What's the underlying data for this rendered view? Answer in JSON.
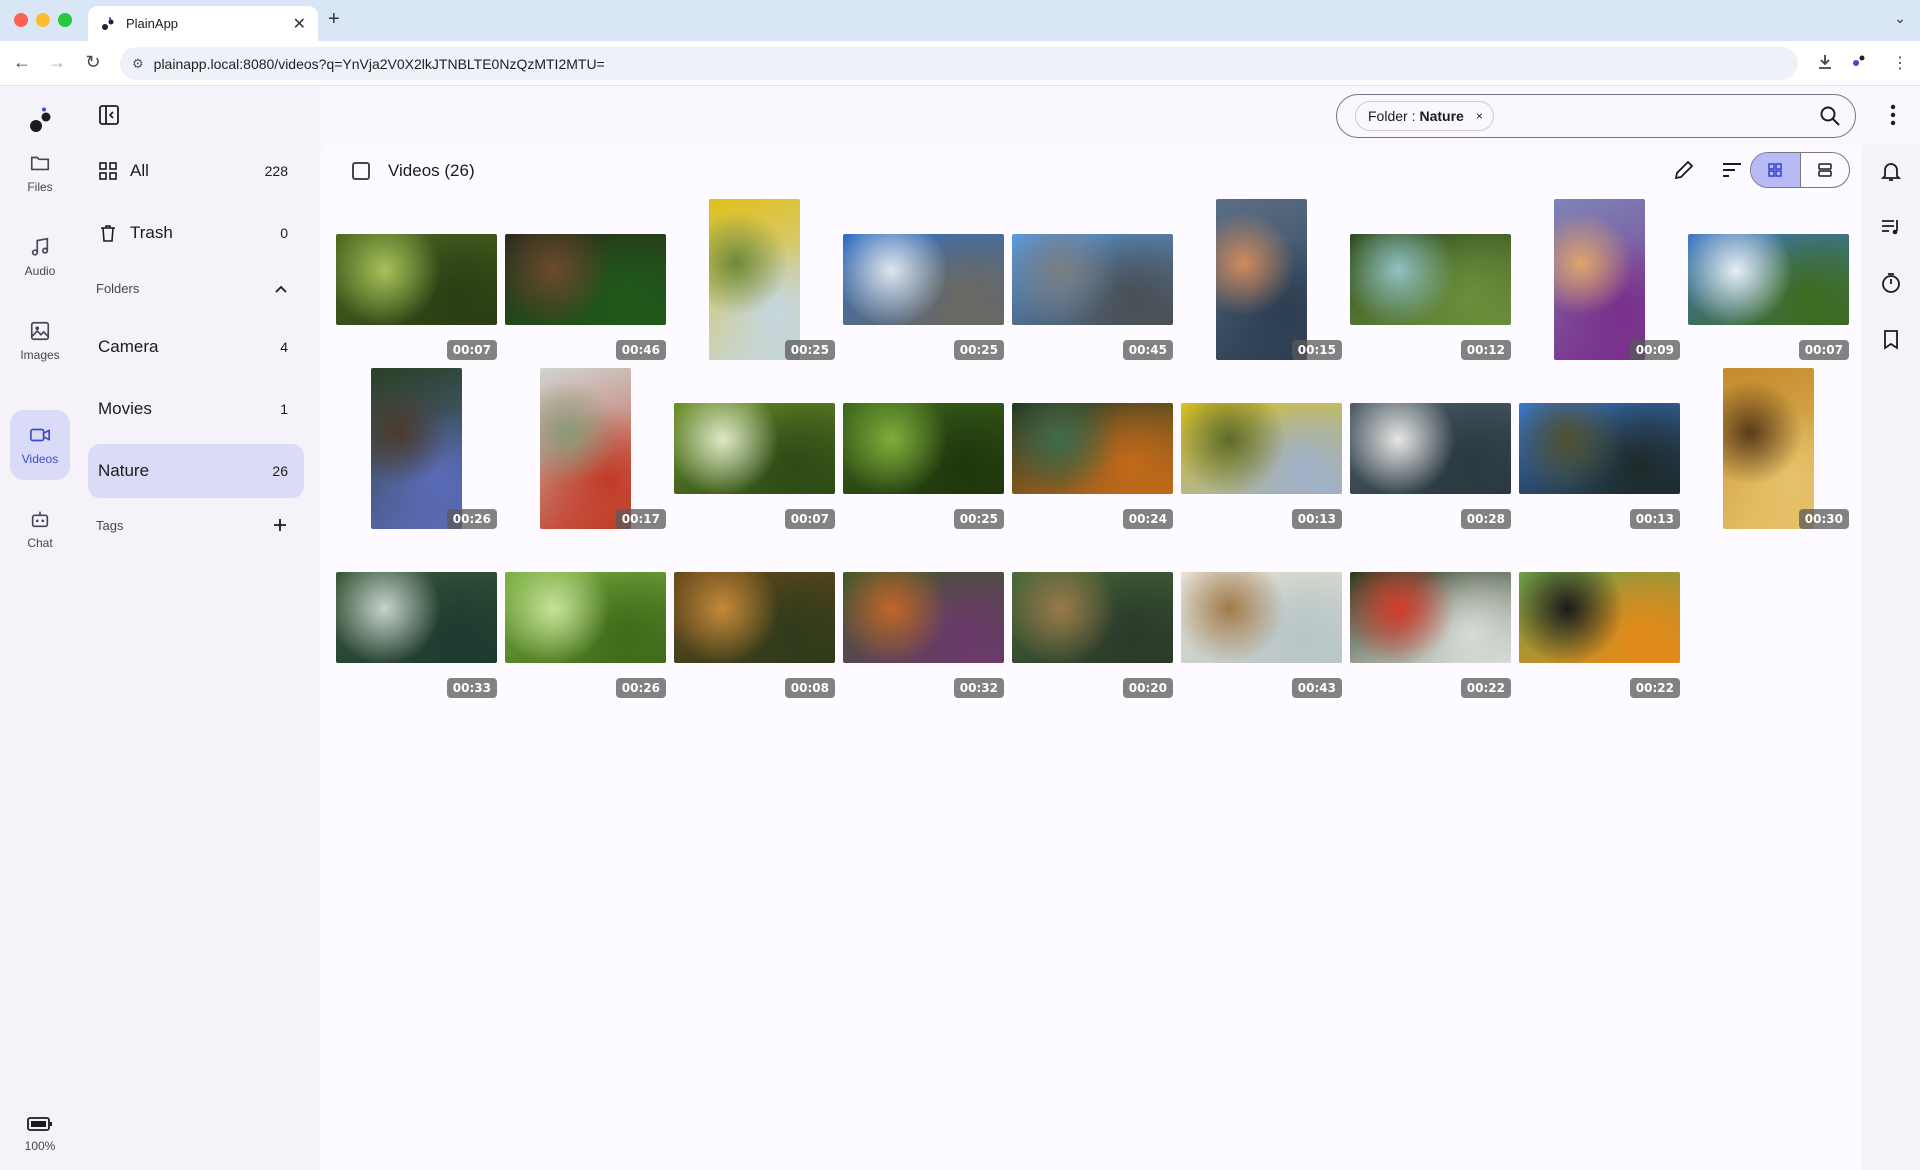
{
  "browser": {
    "tab_title": "PlainApp",
    "url": "plainapp.local:8080/videos?q=YnVja2V0X2lkJTNBLTE0NzQzMTI2MTU="
  },
  "rail": {
    "items": [
      {
        "label": "Files",
        "icon": "folder-icon"
      },
      {
        "label": "Audio",
        "icon": "music-note-icon"
      },
      {
        "label": "Images",
        "icon": "image-icon"
      },
      {
        "label": "Videos",
        "icon": "video-camera-icon"
      },
      {
        "label": "Chat",
        "icon": "robot-icon"
      }
    ],
    "battery": "100%"
  },
  "sidebar": {
    "all": {
      "label": "All",
      "count": "228"
    },
    "trash": {
      "label": "Trash",
      "count": "0"
    },
    "folders_heading": "Folders",
    "folders": [
      {
        "label": "Camera",
        "count": "4"
      },
      {
        "label": "Movies",
        "count": "1"
      },
      {
        "label": "Nature",
        "count": "26"
      }
    ],
    "tags_heading": "Tags"
  },
  "search": {
    "chip_key": "Folder :",
    "chip_value": "Nature",
    "chip_remove": "×"
  },
  "main": {
    "title": "Videos (26)"
  },
  "colors": {
    "accent": "#3d4ad0",
    "active_bg": "#dadbf7",
    "toggle_on": "#b7baf5"
  },
  "videos": [
    {
      "duration": "00:07",
      "orientation": "landscape",
      "colors": [
        "#4f6a22",
        "#a7c25a",
        "#2b3d13"
      ]
    },
    {
      "duration": "00:46",
      "orientation": "landscape",
      "colors": [
        "#2d2a1e",
        "#6d4a2c",
        "#1f5a19"
      ]
    },
    {
      "duration": "00:25",
      "orientation": "portrait",
      "colors": [
        "#e1c01b",
        "#6e8a3a",
        "#c5d6e0"
      ]
    },
    {
      "duration": "00:25",
      "orientation": "landscape",
      "colors": [
        "#2e6fc7",
        "#dfe6ee",
        "#6b6860"
      ]
    },
    {
      "duration": "00:45",
      "orientation": "landscape",
      "colors": [
        "#5b9be0",
        "#7a7e82",
        "#4a4f54"
      ]
    },
    {
      "duration": "00:15",
      "orientation": "portrait",
      "colors": [
        "#5a6f86",
        "#d08a5c",
        "#2d3e52"
      ]
    },
    {
      "duration": "00:12",
      "orientation": "landscape",
      "colors": [
        "#2f4a1f",
        "#8fc2c4",
        "#6a8e3b"
      ]
    },
    {
      "duration": "00:09",
      "orientation": "portrait",
      "colors": [
        "#7e84b7",
        "#e0a56a",
        "#7a2f8a"
      ]
    },
    {
      "duration": "00:07",
      "orientation": "landscape",
      "colors": [
        "#3f79c7",
        "#e6eef6",
        "#3d6b1e"
      ]
    },
    {
      "duration": "00:26",
      "orientation": "portrait",
      "colors": [
        "#2a4024",
        "#4c3a2e",
        "#5a6bb8"
      ]
    },
    {
      "duration": "00:17",
      "orientation": "portrait",
      "colors": [
        "#cfd5d2",
        "#8a9a78",
        "#c23b26"
      ]
    },
    {
      "duration": "00:07",
      "orientation": "landscape",
      "colors": [
        "#6b8f2a",
        "#dfe8c8",
        "#2e4a16"
      ]
    },
    {
      "duration": "00:25",
      "orientation": "landscape",
      "colors": [
        "#3f6a1c",
        "#7fae3c",
        "#20360e"
      ]
    },
    {
      "duration": "00:24",
      "orientation": "landscape",
      "colors": [
        "#1f3a25",
        "#3f6b4b",
        "#c26a1a"
      ]
    },
    {
      "duration": "00:13",
      "orientation": "landscape",
      "colors": [
        "#d9c21a",
        "#5e6a2a",
        "#9fb0c9"
      ]
    },
    {
      "duration": "00:28",
      "orientation": "landscape",
      "colors": [
        "#4f5f6a",
        "#e7e7e4",
        "#2a3840"
      ]
    },
    {
      "duration": "00:13",
      "orientation": "landscape",
      "colors": [
        "#3c78cc",
        "#50502c",
        "#1e2a2a"
      ]
    },
    {
      "duration": "00:30",
      "orientation": "portrait",
      "colors": [
        "#c48a2a",
        "#5a3b1a",
        "#e6c26a"
      ]
    },
    {
      "duration": "00:33",
      "orientation": "landscape",
      "colors": [
        "#3a5a3a",
        "#c7d2cc",
        "#1f3a30"
      ]
    },
    {
      "duration": "00:26",
      "orientation": "landscape",
      "colors": [
        "#7cb341",
        "#c7e29a",
        "#3f6a1a"
      ]
    },
    {
      "duration": "00:08",
      "orientation": "landscape",
      "colors": [
        "#6a4a1c",
        "#c48a3a",
        "#2f3a1a"
      ]
    },
    {
      "duration": "00:32",
      "orientation": "landscape",
      "colors": [
        "#3e5a2a",
        "#c2652a",
        "#6b3a6a"
      ]
    },
    {
      "duration": "00:20",
      "orientation": "landscape",
      "colors": [
        "#4a6a3a",
        "#9a7a4a",
        "#2a3a2a"
      ]
    },
    {
      "duration": "00:43",
      "orientation": "landscape",
      "colors": [
        "#e8e2d4",
        "#a07a4a",
        "#b8c6c8"
      ]
    },
    {
      "duration": "00:22",
      "orientation": "landscape",
      "colors": [
        "#2a3a1e",
        "#d63a2a",
        "#d8dcd8"
      ]
    },
    {
      "duration": "00:22",
      "orientation": "landscape",
      "colors": [
        "#6aa04a",
        "#1a1a1a",
        "#e58a1a"
      ]
    }
  ]
}
